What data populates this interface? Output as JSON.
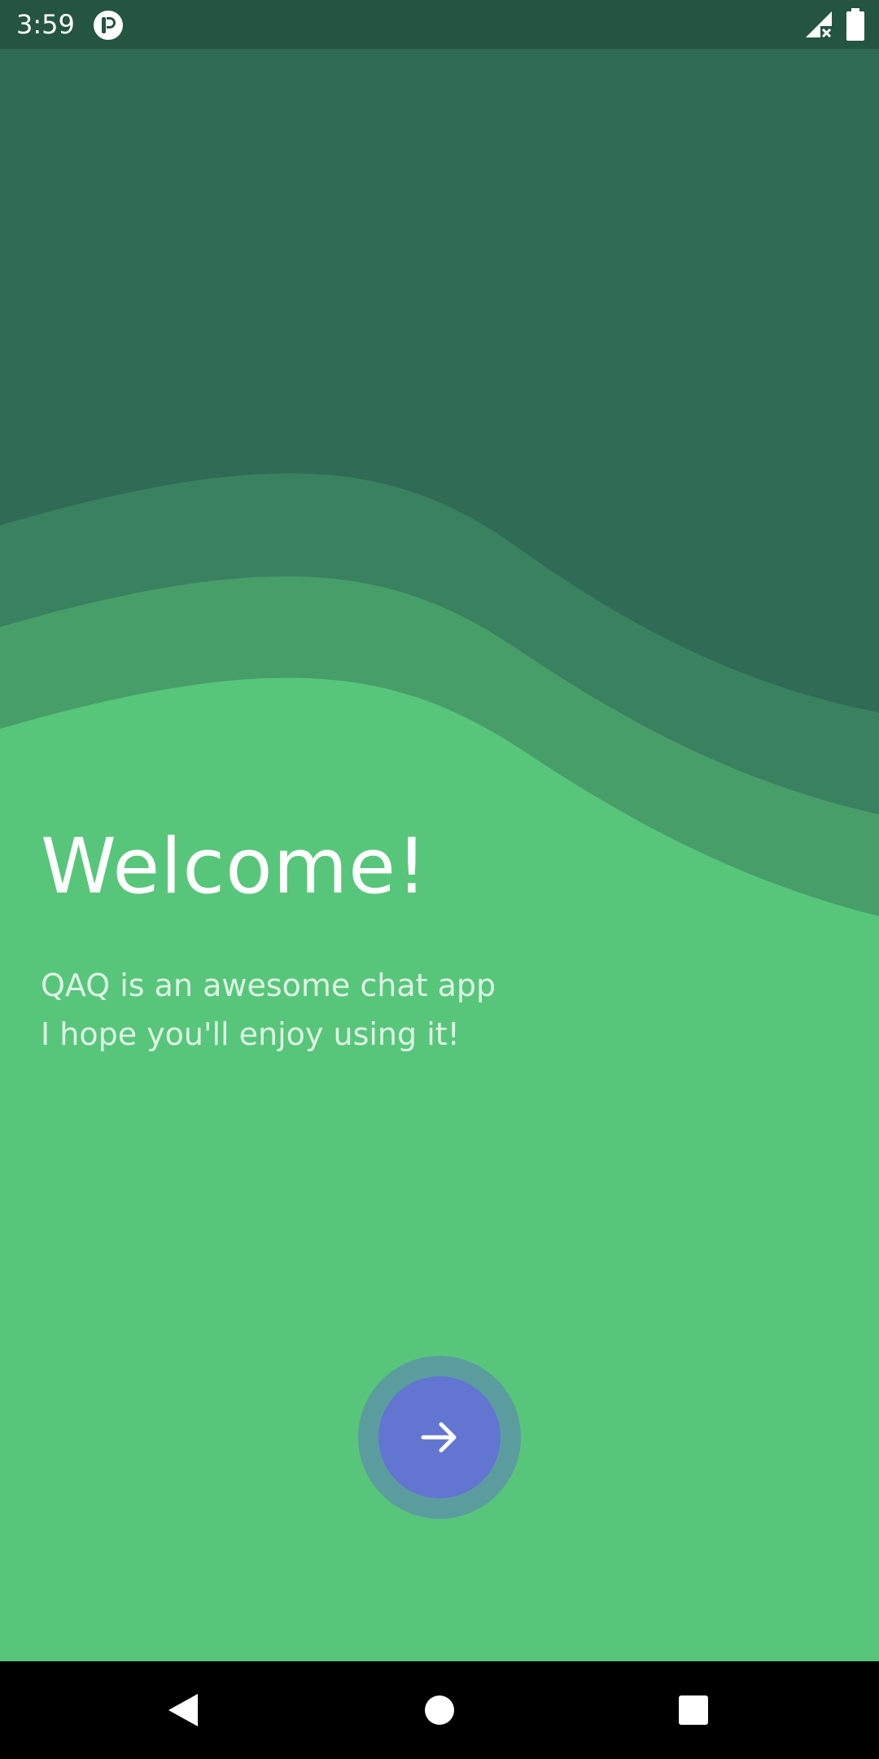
{
  "status_bar": {
    "time": "3:59",
    "app_icon": "pocket-casts-style-icon",
    "signal_icon": "signal-no-service-icon",
    "battery_icon": "battery-full-icon"
  },
  "welcome": {
    "title": "Welcome!",
    "line1": "QAQ is an awesome chat app",
    "line2": "I hope you'll enjoy using it!"
  },
  "next_button": {
    "icon": "arrow-right-icon"
  },
  "nav_bar": {
    "back_icon": "back-triangle-icon",
    "home_icon": "home-circle-icon",
    "recents_icon": "recents-square-icon"
  },
  "colors": {
    "background": "#57c67a",
    "wave_dark": "#2f6b55",
    "wave_mid": "#3a8160",
    "wave_light": "#479e69",
    "status_bar": "#245442",
    "button_outer": "#5b9d9e",
    "button_inner": "#6275d1"
  }
}
